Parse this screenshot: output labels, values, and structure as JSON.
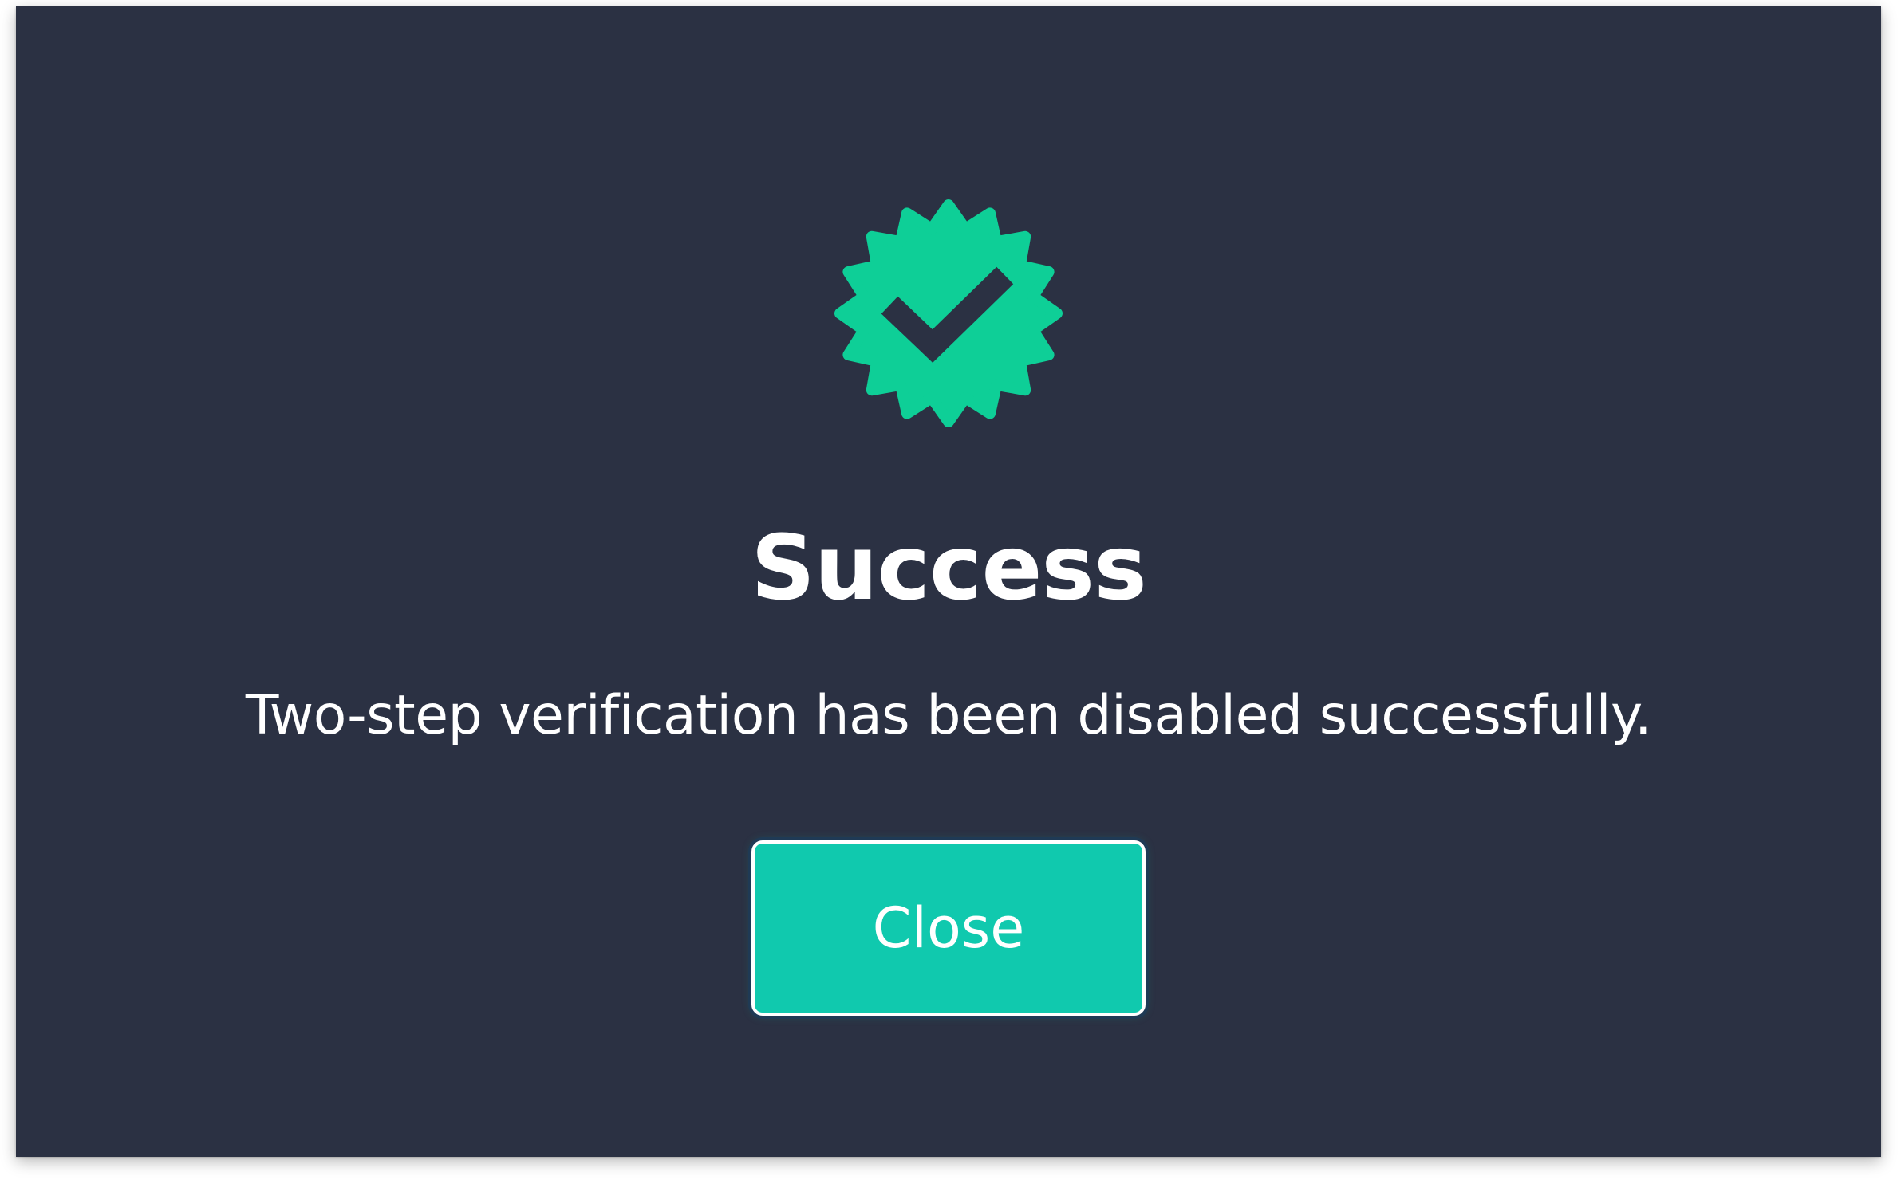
{
  "dialog": {
    "icon": "verified-badge-icon",
    "title": "Success",
    "message": "Two-step verification has been disabled successfully.",
    "close_label": "Close"
  },
  "colors": {
    "background": "#2b3143",
    "badge": "#0ecf97",
    "button": "#10c9ae",
    "text": "#ffffff"
  }
}
